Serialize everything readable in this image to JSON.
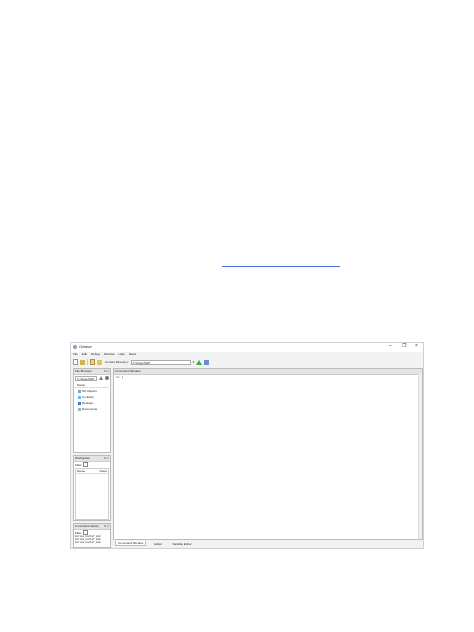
{
  "window": {
    "title": "Octave",
    "controls": [
      "–",
      "❐",
      "×"
    ]
  },
  "menu": [
    "File",
    "Edit",
    "Debug",
    "Window",
    "Help",
    "News"
  ],
  "toolbar": {
    "current_directory_label": "Current Directory:",
    "current_directory_value": "C:\\OpenSHP",
    "dropdown": "▾"
  },
  "file_browser": {
    "title": "File Browser",
    "controls": "⊡ ×",
    "path": "C:\\OpenSHP",
    "header": "Name",
    "items": [
      {
        "label": "3D Objects",
        "color": "#6fa8dc"
      },
      {
        "label": "Contacts",
        "color": "#7fb4e0"
      },
      {
        "label": "Desktop",
        "color": "#3d7fd0"
      },
      {
        "label": "Documents",
        "color": "#9cb0c8"
      }
    ]
  },
  "workspace": {
    "title": "Workspace",
    "controls": "⊡ ×",
    "filter_label": "Filter",
    "columns": [
      "Name",
      "Class"
    ]
  },
  "command_history": {
    "title": "Command History",
    "controls": "⊡ ×",
    "filter_label": "Filter",
    "entries": [
      "kolles_kontaf_mom",
      "kolles_kontaf_mom",
      "kolles_kontaf_mom",
      "kolles_kontaf_mom",
      "kolles_kontaf_mom",
      "# Octave 8.4.0"
    ]
  },
  "command_window": {
    "title": "Command Window",
    "prompt": ">> |"
  },
  "tabs": [
    "Command Window",
    "Editor",
    "Variable Editor"
  ]
}
